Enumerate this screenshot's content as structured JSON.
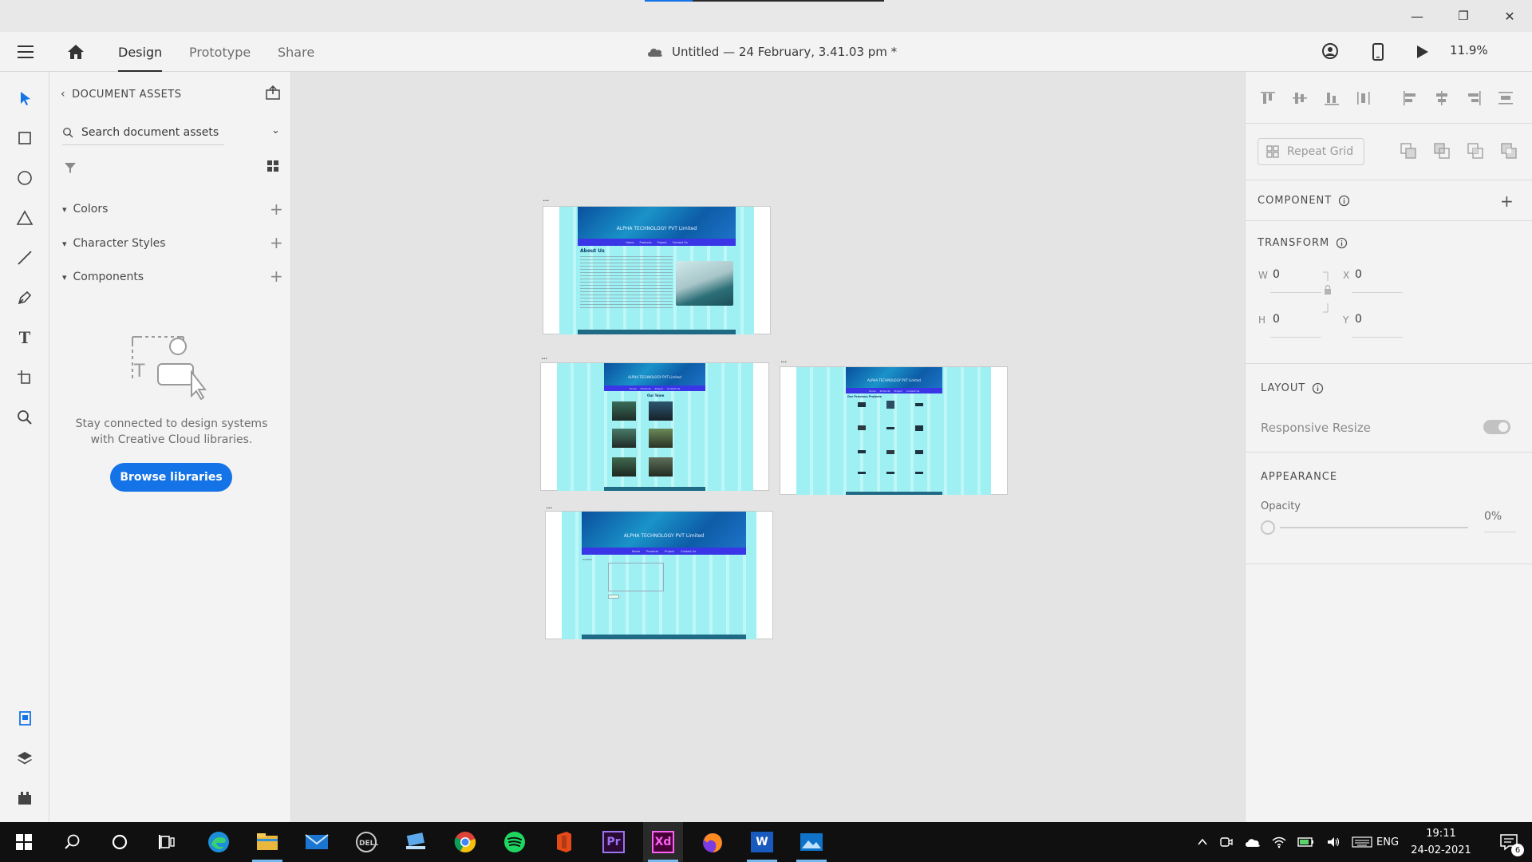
{
  "window": {
    "minimize_glyph": "—",
    "restore_glyph": "❐",
    "close_glyph": "✕"
  },
  "menubar": {
    "tabs": [
      {
        "label": "Design",
        "active": true
      },
      {
        "label": "Prototype",
        "active": false
      },
      {
        "label": "Share",
        "active": false
      }
    ],
    "document_title": "Untitled — 24 February, 3.41.03 pm *",
    "zoom": "11.9%"
  },
  "toolbar": {
    "tools": [
      "select-tool",
      "rectangle-tool",
      "ellipse-tool",
      "polygon-tool",
      "line-tool",
      "pen-tool",
      "text-tool",
      "artboard-tool",
      "zoom-tool"
    ],
    "bottom": [
      "document-assets-icon",
      "layers-icon",
      "plugins-icon"
    ]
  },
  "assets": {
    "header": "DOCUMENT ASSETS",
    "search_placeholder": "Search document assets",
    "sections": [
      {
        "label": "Colors"
      },
      {
        "label": "Character Styles"
      },
      {
        "label": "Components"
      }
    ],
    "empty_message": "Stay connected to design systems with Creative Cloud libraries.",
    "browse_button": "Browse libraries"
  },
  "artboards": [
    {
      "name_marker": "...",
      "header_title": "ALPHA TECHNOLOGY PVT Limited",
      "nav_items": [
        "Home",
        "Products",
        "Project",
        "Contact Us"
      ],
      "heading": "About Us"
    },
    {
      "name_marker": "...",
      "header_title": "ALPHA TECHNOLOGY PVT Limited",
      "nav_items": [
        "Home",
        "Products",
        "Project",
        "Contact Us"
      ],
      "heading": "Our Team"
    },
    {
      "name_marker": "...",
      "header_title": "ALPHA TECHNOLOGY PVT Limited",
      "nav_items": [
        "Home",
        "Products",
        "Project",
        "Contact Us"
      ],
      "heading": "Our Previous Projects"
    },
    {
      "name_marker": "...",
      "header_title": "ALPHA TECHNOLOGY PVT Limited",
      "nav_items": [
        "Home",
        "Products",
        "Project",
        "Contact Us"
      ],
      "heading": "Contact"
    }
  ],
  "inspector": {
    "repeat_grid": "Repeat Grid",
    "component_title": "COMPONENT",
    "transform_title": "TRANSFORM",
    "w_label": "W",
    "w_value": "0",
    "h_label": "H",
    "h_value": "0",
    "x_label": "X",
    "x_value": "0",
    "y_label": "Y",
    "y_value": "0",
    "layout_title": "LAYOUT",
    "responsive_resize": "Responsive Resize",
    "appearance_title": "APPEARANCE",
    "opacity_label": "Opacity",
    "opacity_value": "0%"
  },
  "taskbar": {
    "apps": [
      "start-icon",
      "search-icon",
      "cortana-icon",
      "task-view-icon",
      "edge-icon",
      "file-explorer-icon",
      "mail-icon",
      "dell-icon",
      "laptop-app-icon",
      "chrome-icon",
      "spotify-icon",
      "office-icon",
      "premiere-pro-icon",
      "adobe-xd-icon",
      "firefox-icon",
      "word-icon",
      "photos-icon"
    ],
    "language": "ENG",
    "time": "19:11",
    "date": "24-02-2021",
    "notification_count": "6",
    "xd_label": "Xd",
    "pr_label": "Pr",
    "word_label": "W"
  },
  "colors": {
    "accent": "#1473e6",
    "artboard_cyan": "#9ff0f2",
    "nav_blue": "#3a35e6"
  }
}
